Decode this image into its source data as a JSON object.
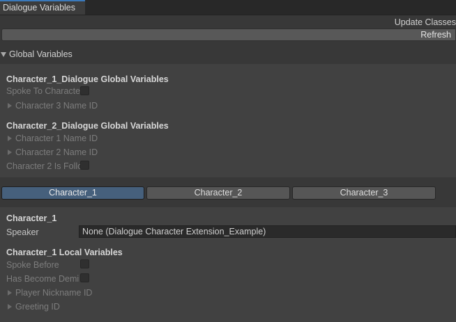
{
  "window": {
    "tab_title": "Dialogue Variables"
  },
  "toolbar": {
    "update_label": "Update Classes",
    "refresh_label": "Refresh"
  },
  "global_foldout": {
    "label": "Global Variables"
  },
  "global_sections": [
    {
      "header": "Character_1_Dialogue Global Variables",
      "rows": [
        {
          "type": "bool",
          "label": "Spoke To Characte"
        },
        {
          "type": "ref",
          "label": "Character 3 Name ID"
        }
      ]
    },
    {
      "header": "Character_2_Dialogue Global Variables",
      "rows": [
        {
          "type": "ref",
          "label": "Character 1 Name ID"
        },
        {
          "type": "ref",
          "label": "Character 2 Name ID"
        },
        {
          "type": "bool",
          "label": "Character 2 Is Follo"
        }
      ]
    }
  ],
  "character_tabs": [
    {
      "label": "Character_1",
      "active": true
    },
    {
      "label": "Character_2",
      "active": false
    },
    {
      "label": "Character_3",
      "active": false
    }
  ],
  "character_panel": {
    "title": "Character_1",
    "speaker_label": "Speaker",
    "speaker_value": "None (Dialogue Character Extension_Example)",
    "local_header": "Character_1 Local Variables",
    "local_rows": [
      {
        "type": "bool",
        "label": "Spoke Before"
      },
      {
        "type": "bool",
        "label": "Has Become Demi"
      },
      {
        "type": "ref",
        "label": "Player Nickname ID"
      },
      {
        "type": "ref",
        "label": "Greeting ID"
      }
    ]
  },
  "colors": {
    "accent": "#3a79bb",
    "active_button": "#46607c",
    "background": "#383838",
    "panel": "#414141"
  }
}
